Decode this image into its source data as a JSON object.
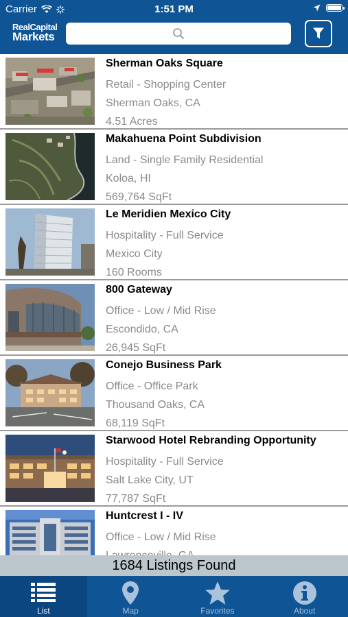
{
  "status_bar": {
    "carrier": "Carrier",
    "time": "1:51 PM"
  },
  "header": {
    "logo_line1": "RealCapital",
    "logo_line2": "Markets",
    "search": {
      "placeholder": "",
      "value": ""
    },
    "icons": {
      "search": "search-icon",
      "filter": "filter-icon"
    }
  },
  "listings": [
    {
      "title": "Sherman Oaks Square",
      "type": "Retail - Shopping Center",
      "location": "Sherman Oaks, CA",
      "size": "4.51 Acres"
    },
    {
      "title": "Makahuena Point Subdivision",
      "type": "Land - Single Family Residential",
      "location": "Koloa, HI",
      "size": "569,764 SqFt"
    },
    {
      "title": "Le Meridien Mexico City",
      "type": "Hospitality - Full Service",
      "location": "Mexico City",
      "size": "160 Rooms"
    },
    {
      "title": "800 Gateway",
      "type": "Office - Low / Mid Rise",
      "location": "Escondido, CA",
      "size": "26,945 SqFt"
    },
    {
      "title": "Conejo Business Park",
      "type": "Office - Office Park",
      "location": "Thousand Oaks, CA",
      "size": "68,119 SqFt"
    },
    {
      "title": "Starwood Hotel Rebranding Opportunity",
      "type": "Hospitality - Full Service",
      "location": "Salt Lake City, UT",
      "size": "77,787 SqFt"
    },
    {
      "title": "Huntcrest I - IV",
      "type": "Office - Low / Mid Rise",
      "location": "Lawrenceville, GA",
      "size": ""
    }
  ],
  "results": {
    "count_text": "1684 Listings Found"
  },
  "tabs": [
    {
      "label": "List",
      "icon": "list-icon",
      "active": true
    },
    {
      "label": "Map",
      "icon": "map-pin-icon",
      "active": false
    },
    {
      "label": "Favorites",
      "icon": "star-icon",
      "active": false
    },
    {
      "label": "About",
      "icon": "info-icon",
      "active": false
    }
  ],
  "colors": {
    "brand": "#0f5595",
    "tab_active": "#0b4680",
    "count_bar": "#bcc6cd",
    "secondary_text": "#8a8a8a"
  }
}
